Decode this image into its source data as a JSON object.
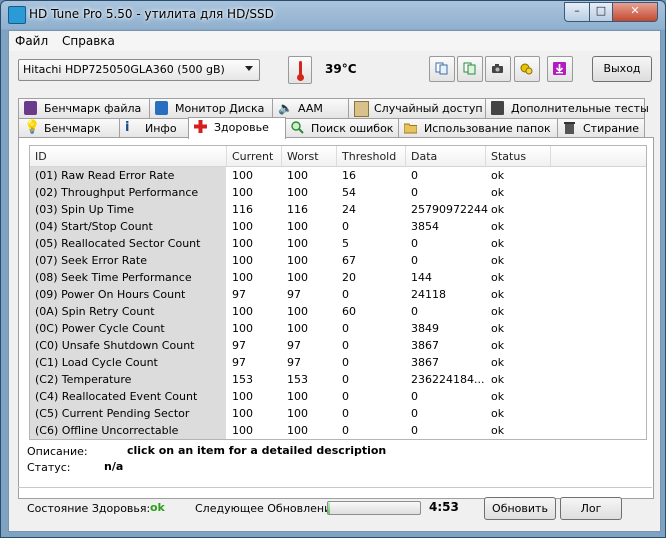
{
  "window": {
    "title": "HD Tune Pro 5.50 - утилита для HD/SSD"
  },
  "menu": {
    "file": "Файл",
    "help": "Справка"
  },
  "toolbar": {
    "drive": "Hitachi HDP725050GLA360 (500 gB)",
    "temperature": "39°C",
    "exit_label": "Выход",
    "icons": [
      "copy-text-icon",
      "copy-screen-icon",
      "camera-icon",
      "options-icon",
      "save-icon"
    ]
  },
  "tabs_row1": [
    {
      "label": "Бенчмарк файла",
      "icon": "file-benchmark-icon"
    },
    {
      "label": "Монитор Диска",
      "icon": "disk-monitor-icon"
    },
    {
      "label": "AAM",
      "icon": "speaker-icon"
    },
    {
      "label": "Случайный доступ",
      "icon": "random-access-icon"
    },
    {
      "label": "Дополнительные тесты",
      "icon": "extra-tests-icon"
    }
  ],
  "tabs_row2": [
    {
      "label": "Бенчмарк",
      "icon": "benchmark-icon"
    },
    {
      "label": "Инфо",
      "icon": "info-icon"
    },
    {
      "label": "Здоровье",
      "icon": "health-icon",
      "active": true
    },
    {
      "label": "Поиск ошибок",
      "icon": "error-scan-icon"
    },
    {
      "label": "Использование папок",
      "icon": "folder-usage-icon"
    },
    {
      "label": "Стирание",
      "icon": "erase-icon"
    }
  ],
  "table": {
    "columns": [
      "ID",
      "Current",
      "Worst",
      "Threshold",
      "Data",
      "Status"
    ],
    "rows": [
      [
        "(01) Raw Read Error Rate",
        "100",
        "100",
        "16",
        "0",
        "ok"
      ],
      [
        "(02) Throughput Performance",
        "100",
        "100",
        "54",
        "0",
        "ok"
      ],
      [
        "(03) Spin Up Time",
        "116",
        "116",
        "24",
        "25790972244",
        "ok"
      ],
      [
        "(04) Start/Stop Count",
        "100",
        "100",
        "0",
        "3854",
        "ok"
      ],
      [
        "(05) Reallocated Sector Count",
        "100",
        "100",
        "5",
        "0",
        "ok"
      ],
      [
        "(07) Seek Error Rate",
        "100",
        "100",
        "67",
        "0",
        "ok"
      ],
      [
        "(08) Seek Time Performance",
        "100",
        "100",
        "20",
        "144",
        "ok"
      ],
      [
        "(09) Power On Hours Count",
        "97",
        "97",
        "0",
        "24118",
        "ok"
      ],
      [
        "(0A) Spin Retry Count",
        "100",
        "100",
        "60",
        "0",
        "ok"
      ],
      [
        "(0C) Power Cycle Count",
        "100",
        "100",
        "0",
        "3849",
        "ok"
      ],
      [
        "(C0) Unsafe Shutdown Count",
        "97",
        "97",
        "0",
        "3867",
        "ok"
      ],
      [
        "(C1) Load Cycle Count",
        "97",
        "97",
        "0",
        "3867",
        "ok"
      ],
      [
        "(C2) Temperature",
        "153",
        "153",
        "0",
        "236224184...",
        "ok"
      ],
      [
        "(C4) Reallocated Event Count",
        "100",
        "100",
        "0",
        "0",
        "ok"
      ],
      [
        "(C5) Current Pending Sector",
        "100",
        "100",
        "0",
        "0",
        "ok"
      ],
      [
        "(C6) Offline Uncorrectable",
        "100",
        "100",
        "0",
        "0",
        "ok"
      ]
    ]
  },
  "description": {
    "label": "Описание:",
    "value": "click on an item for a detailed description"
  },
  "status": {
    "label": "Статус:",
    "value": "n/a"
  },
  "footer": {
    "health_label": "Состояние Здоровья:",
    "health_value": "ok",
    "next_update_label": "Следующее Обновление:",
    "countdown": "4:53",
    "progress": 0.02,
    "refresh_label": "Обновить",
    "log_label": "Лог"
  },
  "colors": {
    "health_ok": "#2e9e1e",
    "close_button": "#c24a2f"
  }
}
